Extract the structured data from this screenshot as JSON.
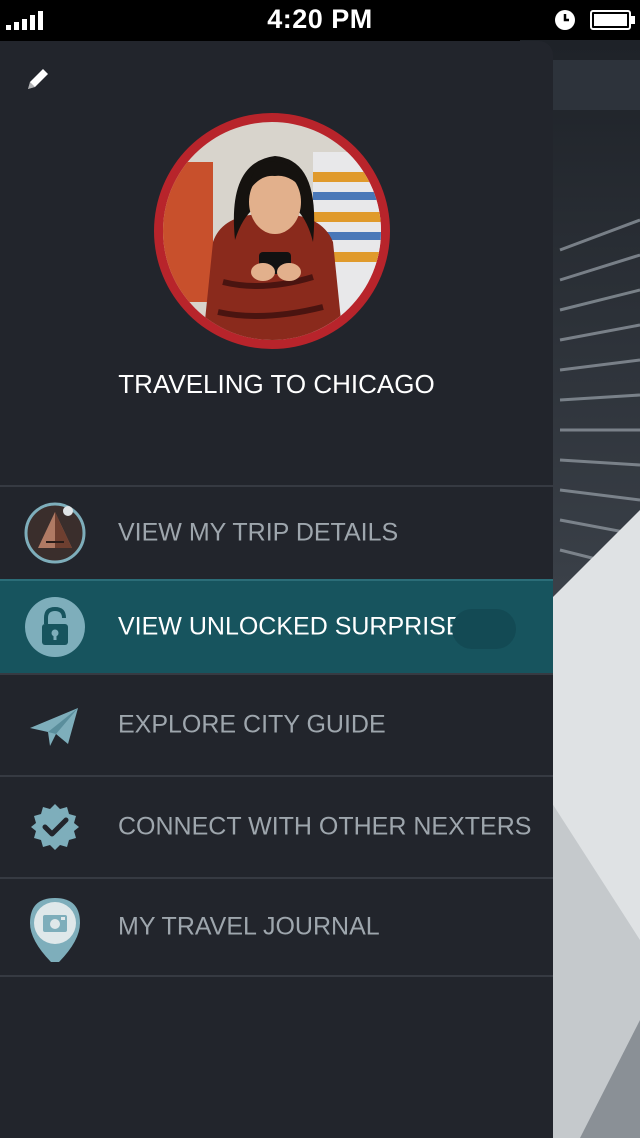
{
  "status_bar": {
    "time": "4:20 PM"
  },
  "profile": {
    "title": "TRAVELING TO CHICAGO"
  },
  "menu": [
    {
      "label": "VIEW MY TRIP DETAILS",
      "icon": "pyramid-icon",
      "active": false
    },
    {
      "label": "VIEW UNLOCKED SURPRISES",
      "icon": "lock-icon",
      "active": true
    },
    {
      "label": "EXPLORE CITY GUIDE",
      "icon": "paper-plane-icon",
      "active": false
    },
    {
      "label": "CONNECT WITH OTHER NEXTERS",
      "icon": "verified-badge-icon",
      "active": false
    },
    {
      "label": "MY TRAVEL JOURNAL",
      "icon": "camera-pin-icon",
      "active": false
    }
  ],
  "colors": {
    "drawer_bg": "#22252c",
    "active_item_bg": "#17545e",
    "icon_teal": "#7eaebb",
    "avatar_ring": "#b8242b"
  }
}
